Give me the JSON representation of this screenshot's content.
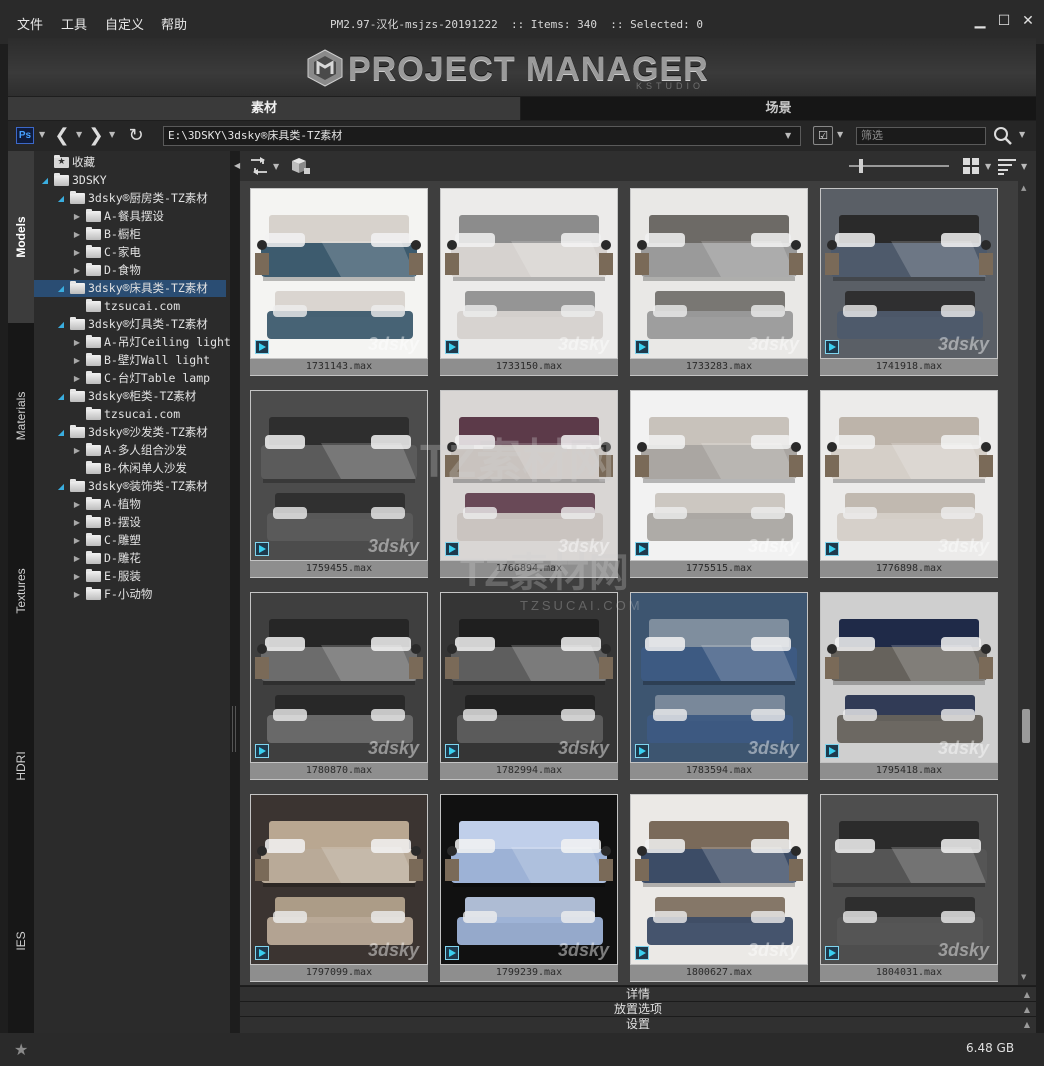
{
  "menu": [
    "文件",
    "工具",
    "自定义",
    "帮助"
  ],
  "window": {
    "title": "PM2.97-汉化-msjzs-20191222  :: Items: 340  :: Selected: 0",
    "controls": [
      "minimize-icon",
      "maximize-icon",
      "close-icon"
    ]
  },
  "banner": {
    "logo_text": "PROJECT MANAGER",
    "logo_sub": "KSTUDIO"
  },
  "tabs": [
    {
      "label": "素材",
      "active": true
    },
    {
      "label": "场景",
      "active": false
    }
  ],
  "navbar": {
    "ps_label": "Ps",
    "path": "E:\\3DSKY\\3dsky®床具类-TZ素材",
    "filter_placeholder": "筛选"
  },
  "side_tabs": [
    "Models",
    "Materials",
    "Textures",
    "HDRI",
    "IES"
  ],
  "active_side_tab": "Models",
  "tree": [
    {
      "label": "收藏"
    },
    {
      "label": "3DSKY"
    },
    {
      "label": "3dsky®厨房类-TZ素材"
    },
    {
      "label": "A-餐具摆设"
    },
    {
      "label": "B-橱柜"
    },
    {
      "label": "C-家电"
    },
    {
      "label": "D-食物"
    },
    {
      "label": "3dsky®床具类-TZ素材"
    },
    {
      "label": "tzsucai.com"
    },
    {
      "label": "3dsky®灯具类-TZ素材"
    },
    {
      "label": "A-吊灯Ceiling light"
    },
    {
      "label": "B-壁灯Wall light"
    },
    {
      "label": "C-台灯Table lamp"
    },
    {
      "label": "3dsky®柜类-TZ素材"
    },
    {
      "label": "tzsucai.com"
    },
    {
      "label": "3dsky®沙发类-TZ素材"
    },
    {
      "label": "A-多人组合沙发"
    },
    {
      "label": "B-休闲单人沙发"
    },
    {
      "label": "3dsky®装饰类-TZ素材"
    },
    {
      "label": "A-植物"
    },
    {
      "label": "B-摆设"
    },
    {
      "label": "C-雕塑"
    },
    {
      "label": "D-雕花"
    },
    {
      "label": "E-服装"
    },
    {
      "label": "F-小动物"
    }
  ],
  "items": [
    {
      "name": "1731143.max",
      "bg": "#f4f4f2",
      "bed": "#3d5b6e",
      "head": "#d7d2cc",
      "lamp": true
    },
    {
      "name": "1733150.max",
      "bg": "#ecebea",
      "bed": "#d6d2cf",
      "head": "#8c8c8c",
      "lamp": true
    },
    {
      "name": "1733283.max",
      "bg": "#e9e8e6",
      "bed": "#9a9a9a",
      "head": "#6d6a66",
      "lamp": true
    },
    {
      "name": "1741918.max",
      "bg": "#5a5f66",
      "bed": "#4e5a6b",
      "head": "#2a2a2a",
      "lamp": true
    },
    {
      "name": "1759455.max",
      "bg": "#4c4c4c",
      "bed": "#5b5b5b",
      "head": "#2e2e2e",
      "lamp": false
    },
    {
      "name": "1766894.max",
      "bg": "#d9d6d4",
      "bed": "#c9c3bf",
      "head": "#5c3a49",
      "lamp": true
    },
    {
      "name": "1775515.max",
      "bg": "#f2f2f2",
      "bed": "#aaa6a2",
      "head": "#c8c2bb",
      "lamp": true
    },
    {
      "name": "1776898.max",
      "bg": "#ecebea",
      "bed": "#d5cfc8",
      "head": "#bdb4aa",
      "lamp": true
    },
    {
      "name": "1780870.max",
      "bg": "#3f3f3f",
      "bed": "#6c6c6c",
      "head": "#262626",
      "lamp": true
    },
    {
      "name": "1782994.max",
      "bg": "#353535",
      "bed": "#5e5e5e",
      "head": "#1f1f1f",
      "lamp": true
    },
    {
      "name": "1783594.max",
      "bg": "#3d5570",
      "bed": "#3d5a82",
      "head": "#7f8e9e",
      "lamp": false
    },
    {
      "name": "1795418.max",
      "bg": "#cfcfcf",
      "bed": "#66625c",
      "head": "#1f2a48",
      "lamp": true
    },
    {
      "name": "1797099.max",
      "bg": "#3b3431",
      "bed": "#b9aa98",
      "head": "#b9a791",
      "lamp": true
    },
    {
      "name": "1799239.max",
      "bg": "#111111",
      "bed": "#9db2d6",
      "head": "#c0cfea",
      "lamp": true
    },
    {
      "name": "1800627.max",
      "bg": "#ebe9e6",
      "bed": "#3c4c66",
      "head": "#7a6a5a",
      "lamp": true
    },
    {
      "name": "1804031.max",
      "bg": "#4e4e4e",
      "bed": "#555555",
      "head": "#2b2b2b",
      "lamp": false
    }
  ],
  "thumb_watermark": "3dsky",
  "watermark": {
    "line1": "TZ素材网",
    "line2": "TZ素材网",
    "line3": "TZSUCAI.COM"
  },
  "panels": [
    "详情",
    "放置选项",
    "设置"
  ],
  "status": {
    "disk_size": "6.48 GB"
  },
  "colors": {
    "selection": "#2a4d73",
    "accent": "#3aaee0",
    "background": "#1e1e1e"
  }
}
